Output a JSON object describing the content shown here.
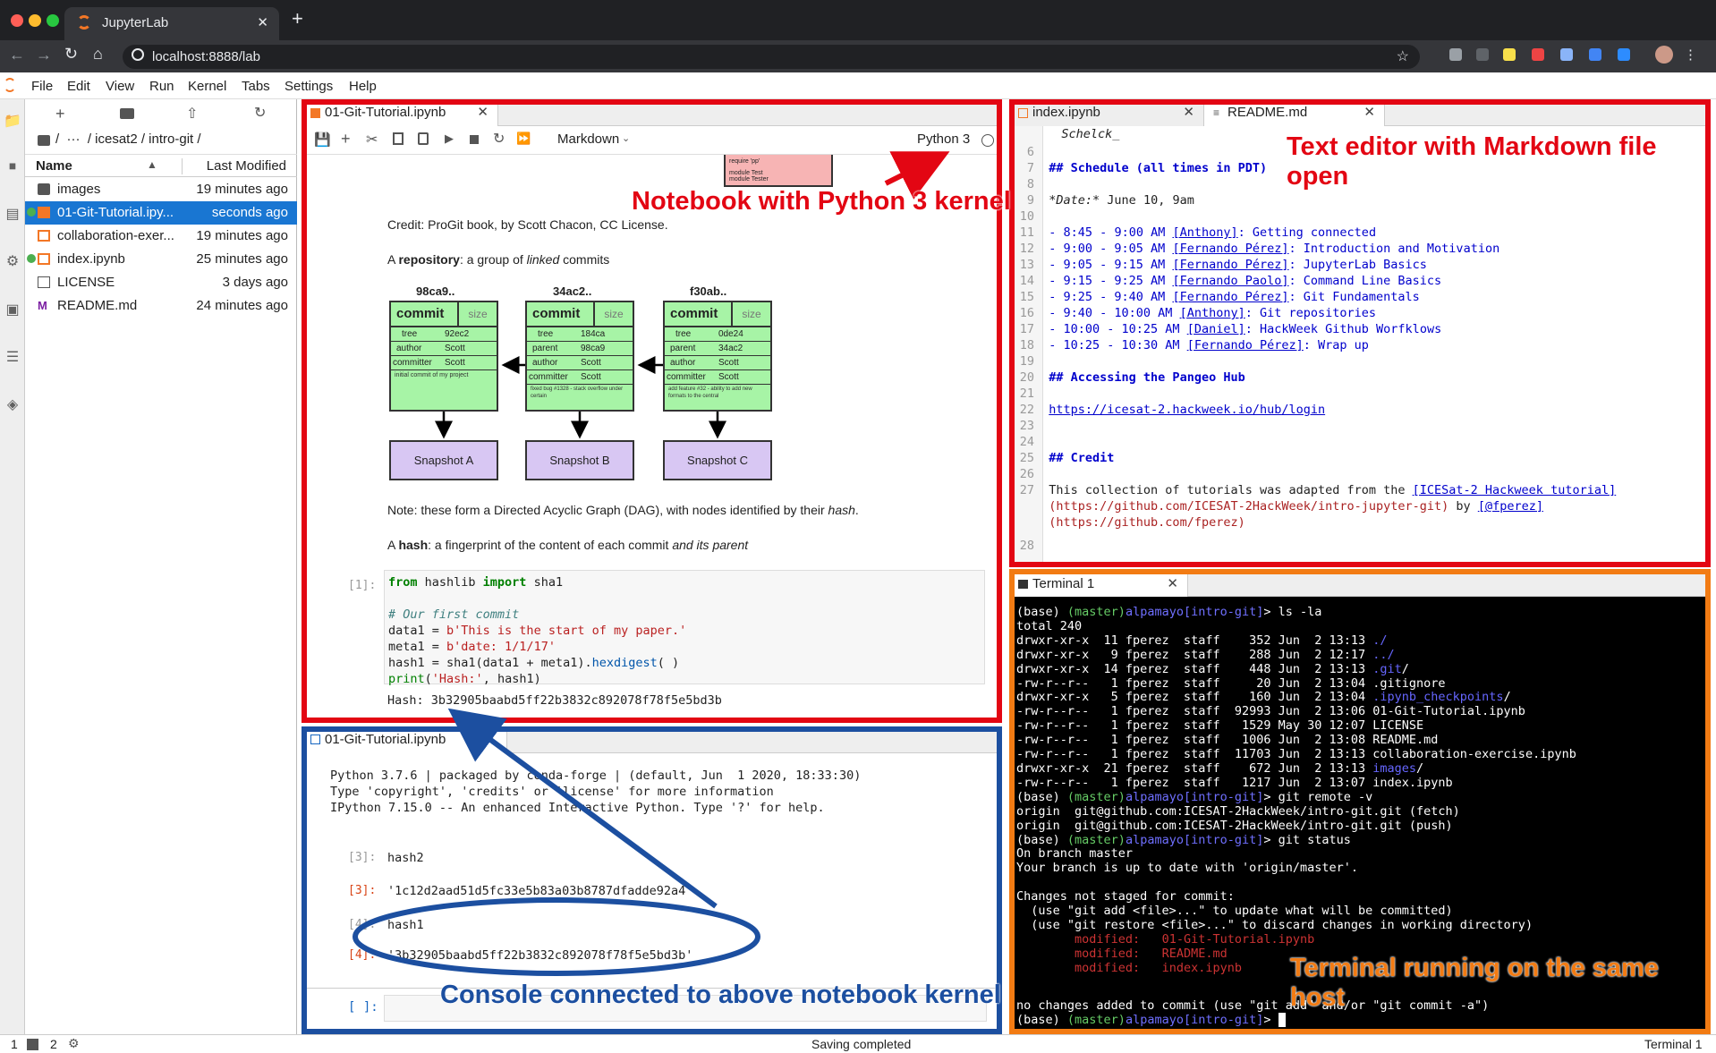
{
  "browser": {
    "tab_title": "JupyterLab",
    "url": "localhost:8888/lab",
    "close": "✕",
    "new_tab": "+"
  },
  "menu": [
    "File",
    "Edit",
    "View",
    "Run",
    "Kernel",
    "Tabs",
    "Settings",
    "Help"
  ],
  "filebrowser": {
    "breadcrumb": "/  ···  / icesat2 / intro-git /",
    "col_name": "Name",
    "col_modified": "Last Modified",
    "files": [
      {
        "name": "images",
        "modified": "19 minutes ago",
        "icon": "folder-icon"
      },
      {
        "name": "01-Git-Tutorial.ipy...",
        "modified": "seconds ago",
        "icon": "notebook-icon"
      },
      {
        "name": "collaboration-exer...",
        "modified": "19 minutes ago",
        "icon": "notebook-icon"
      },
      {
        "name": "index.ipynb",
        "modified": "25 minutes ago",
        "icon": "notebook-icon"
      },
      {
        "name": "LICENSE",
        "modified": "3 days ago",
        "icon": "file-icon"
      },
      {
        "name": "README.md",
        "modified": "24 minutes ago",
        "icon": "markdown-icon"
      }
    ]
  },
  "notebook": {
    "tab": "01-Git-Tutorial.ipynb",
    "cell_type": "Markdown",
    "kernel": "Python 3",
    "top_snippet": [
      "require 'pp'",
      "module Test",
      "  module Tester"
    ],
    "credit": "Credit: ProGit book, by Scott Chacon, CC License.",
    "repo_a": "A ",
    "repo_b": "repository",
    "repo_c": ": a group of ",
    "repo_d": "linked",
    "repo_e": " commits",
    "commits": [
      {
        "hash": "98ca9..",
        "tree": "92ec2",
        "parent": "",
        "author": "Scott",
        "committer": "Scott",
        "msg": "initial commit of my project"
      },
      {
        "hash": "34ac2..",
        "tree": "184ca",
        "parent": "98ca9",
        "author": "Scott",
        "committer": "Scott",
        "msg": "fixed bug #1328 - stack overflow under certain"
      },
      {
        "hash": "f30ab..",
        "tree": "0de24",
        "parent": "34ac2",
        "author": "Scott",
        "committer": "Scott",
        "msg": "add feature #32 - ability to add new formats to the central"
      }
    ],
    "commit_word": "commit",
    "size_word": "size",
    "field_labels": {
      "tree": "tree",
      "parent": "parent",
      "author": "author",
      "committer": "committer"
    },
    "snapshots": [
      "Snapshot A",
      "Snapshot B",
      "Snapshot C"
    ],
    "note_a": "Note: these form a Directed Acyclic Graph (DAG), with nodes identified by their ",
    "note_b": "hash",
    "note_c": ".",
    "hash_a": "A ",
    "hash_b": "hash",
    "hash_c": ": a fingerprint of the content of each commit ",
    "hash_d": "and its parent",
    "cell_prompt": "[1]:",
    "output": "Hash: 3b32905baabd5ff22b3832c892078f78f5e5bd3b"
  },
  "console": {
    "tab": "01-Git-Tutorial.ipynb",
    "banner": [
      "Python 3.7.6 | packaged by conda-forge | (default, Jun  1 2020, 18:33:30)",
      "Type 'copyright', 'credits' or 'license' for more information",
      "IPython 7.15.0 -- An enhanced Interactive Python. Type '?' for help."
    ],
    "in3_prompt": "[3]:",
    "in3": "hash2",
    "out3_prompt": "[3]:",
    "out3": "'1c12d2aad51d5fc33e5b83a03b8787dfadde92a4'",
    "in4_prompt": "[4]:",
    "in4": "hash1",
    "out4_prompt": "[4]:",
    "out4": "'3b32905baabd5ff22b3832c892078f78f5e5bd3b'",
    "input_prompt": "[ ]:"
  },
  "editor": {
    "tabs": [
      "index.ipynb",
      "README.md"
    ],
    "top_partial": "Schelck_"
  },
  "terminal": {
    "tab": "Terminal 1",
    "final": "no changes added to commit (use \"git add\" and/or \"git commit -a\")"
  },
  "annotations": {
    "notebook": "Notebook with Python 3 kernel",
    "editor": "Text editor with Markdown file open",
    "terminal": "Terminal running on the same host",
    "console": "Console connected to above notebook kernel"
  },
  "statusbar": {
    "left1": "1",
    "left2": "2",
    "center": "Saving completed",
    "right": "Terminal 1"
  },
  "colors": {
    "notebook_box": "#e30613",
    "console_box": "#1c4fa0",
    "terminal_box": "#f27b13"
  }
}
